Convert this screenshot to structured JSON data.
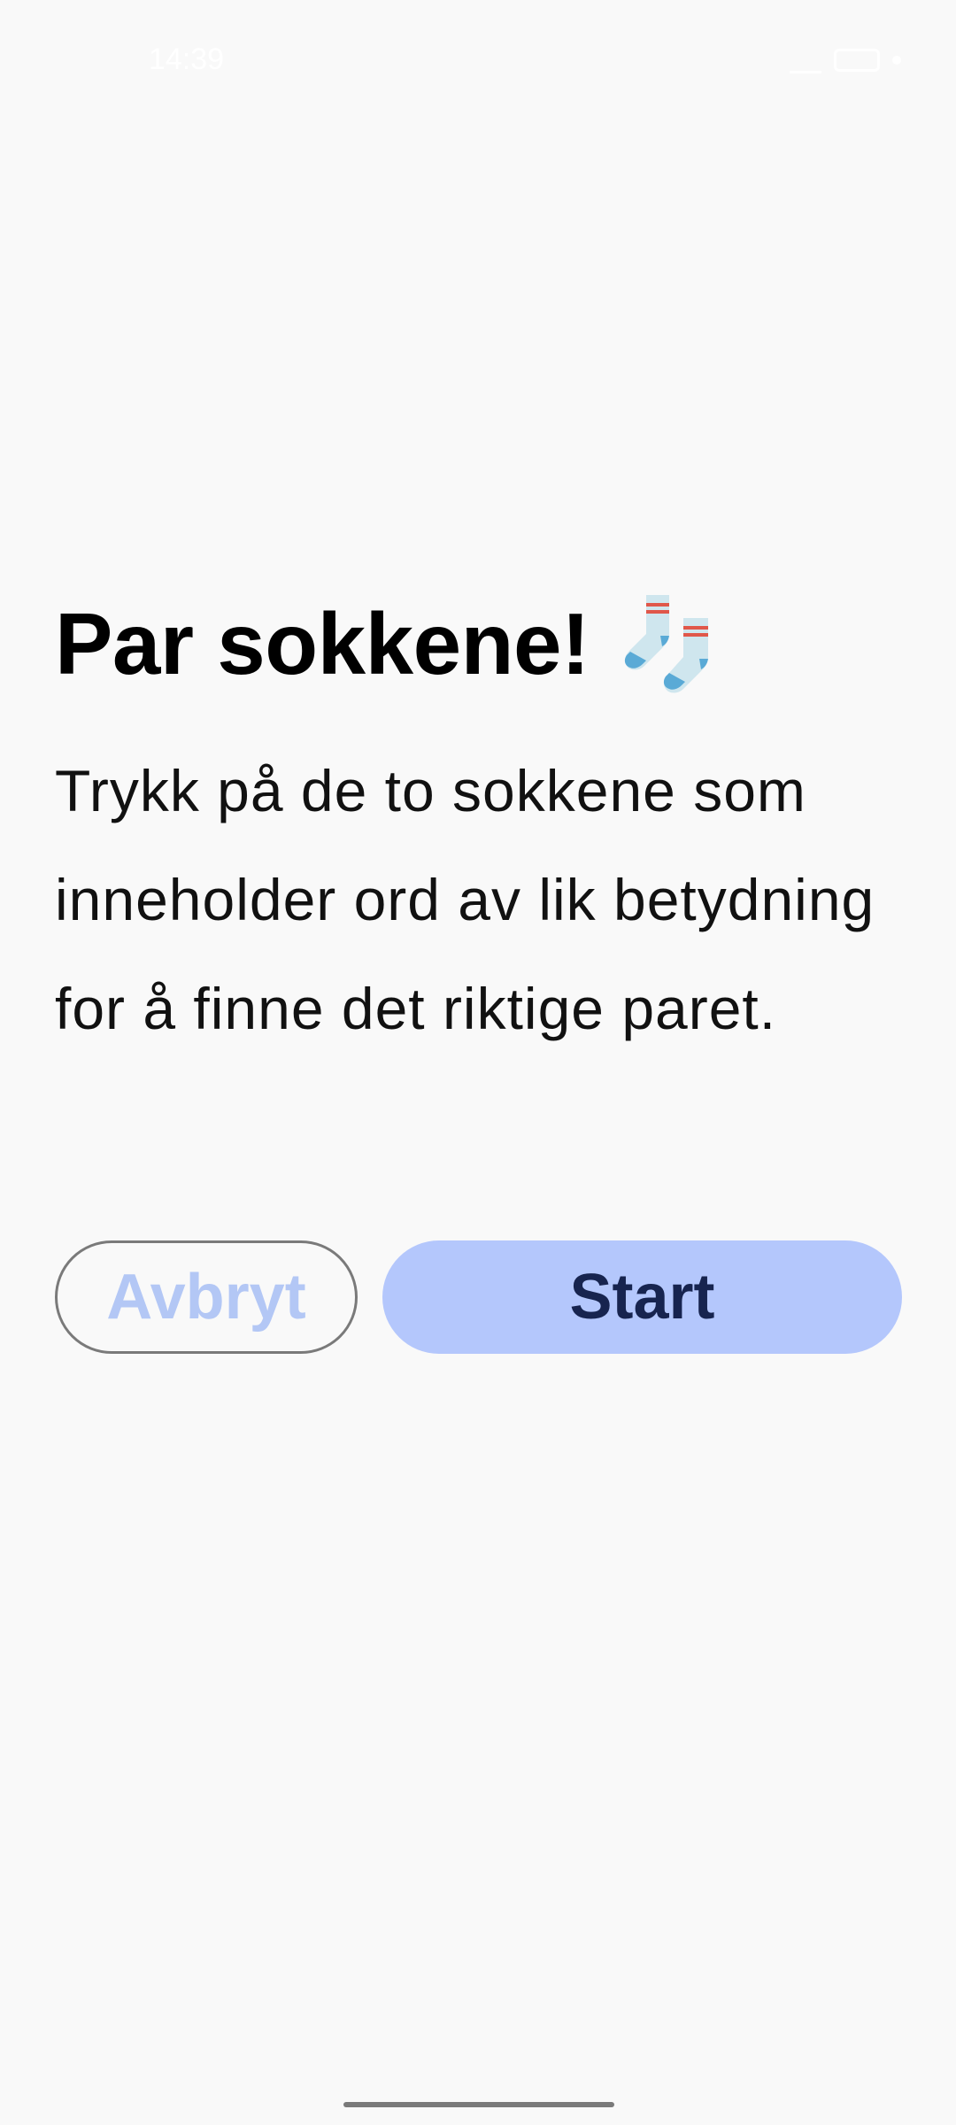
{
  "status_bar": {
    "time": "14:39"
  },
  "game_intro": {
    "title": "Par sokkene!",
    "title_emoji_icon": "socks-icon",
    "instructions": "Trykk på de to sokkene som inneholder ord av lik betydning for å finne det riktige paret."
  },
  "actions": {
    "cancel_label": "Avbryt",
    "start_label": "Start"
  },
  "colors": {
    "background": "#f9f9f9",
    "start_button_bg": "#b4c7fc",
    "start_button_text": "#17244f",
    "cancel_button_text": "#b3c7f5",
    "cancel_button_border": "#7a7a7a"
  }
}
